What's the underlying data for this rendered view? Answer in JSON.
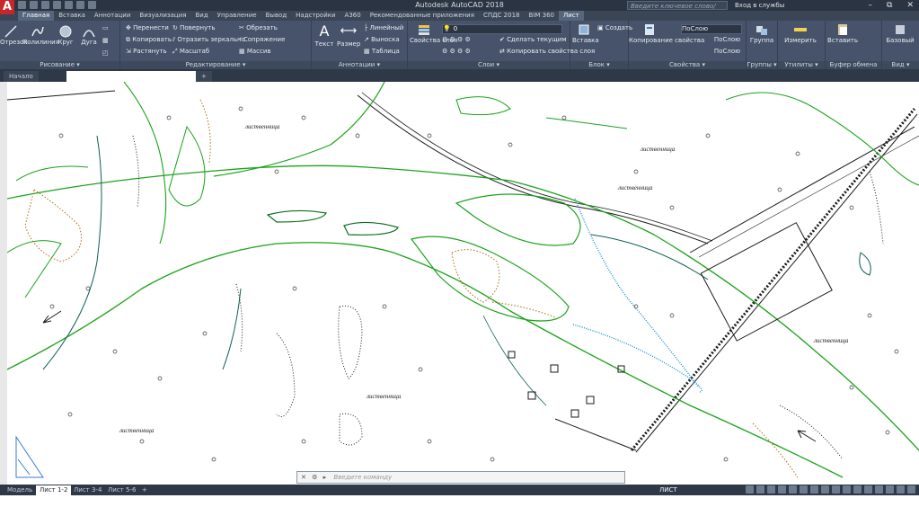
{
  "app": {
    "title": "Autodesk AutoCAD 2018",
    "logo_letter": "A"
  },
  "search": {
    "placeholder": "Введите ключевое слово/фразу"
  },
  "user": {
    "signin": "Вход в службы"
  },
  "window_controls": {
    "minimize": "–",
    "restore": "⧉",
    "close": "✕"
  },
  "ribbon_tabs": [
    "Главная",
    "Вставка",
    "Аннотации",
    "Визуализация",
    "Вид",
    "Управление",
    "Вывод",
    "Надстройки",
    "A360",
    "Рекомендованные приложения",
    "СПДС 2018",
    "BIM 360",
    "Лист"
  ],
  "ribbon": {
    "draw": {
      "title": "Рисование ▾",
      "line": "Отрезок",
      "polyline": "Полилиния",
      "circle": "Круг",
      "arc": "Дуга"
    },
    "modify": {
      "title": "Редактирование ▾",
      "move": "Перенести",
      "rotate": "Повернуть",
      "trim": "Обрезать",
      "copy": "Копировать",
      "mirror": "Отразить зеркально",
      "fillet": "Сопряжение",
      "stretch": "Растянуть",
      "scale": "Масштаб",
      "array": "Массив"
    },
    "annotation": {
      "title": "Аннотации ▾",
      "text": "Текст",
      "dimension": "Размер",
      "linear": "Линейный",
      "leader": "Выноска",
      "table": "Таблица"
    },
    "layers": {
      "title": "Слои ▾",
      "layer_props": "Свойства слоя",
      "current_layer": "0",
      "make_current": "Сделать текущим",
      "match_layer": "Копировать свойства слоя"
    },
    "block": {
      "title": "Блок ▾",
      "insert": "Вставка",
      "create": "Создать"
    },
    "properties": {
      "title": "Свойства ▾",
      "match": "Копирование свойства",
      "color": "ПоСлою",
      "linetype": "ПоСлою",
      "lineweight": "ПоСлою"
    },
    "groups": {
      "title": "Группы ▾",
      "group": "Группа"
    },
    "utilities": {
      "title": "Утилиты ▾",
      "measure": "Измерить"
    },
    "clipboard": {
      "title": "Буфер обмена",
      "paste": "Вставить"
    },
    "view": {
      "title": "Вид ▾",
      "base": "Базовый"
    }
  },
  "file_tabs": {
    "start": "Начало",
    "current": "",
    "add": "+"
  },
  "map_labels": [
    "лиственница",
    "лиственница",
    "лиственница",
    "лиственница",
    "лиственница",
    "лиственница"
  ],
  "command_line": {
    "placeholder": "Введите команду"
  },
  "layout_tabs": [
    "Модель",
    "Лист 1-2",
    "Лист 3-4",
    "Лист 5-6",
    "+"
  ],
  "status": {
    "mode": "ЛИСТ"
  },
  "colors": {
    "river_green": "#1aa31a",
    "water_blue": "#1f8fd6",
    "dark_line": "#1a1a1a",
    "dotted_orange": "#b06a10",
    "dark_teal": "#0d5f57"
  }
}
